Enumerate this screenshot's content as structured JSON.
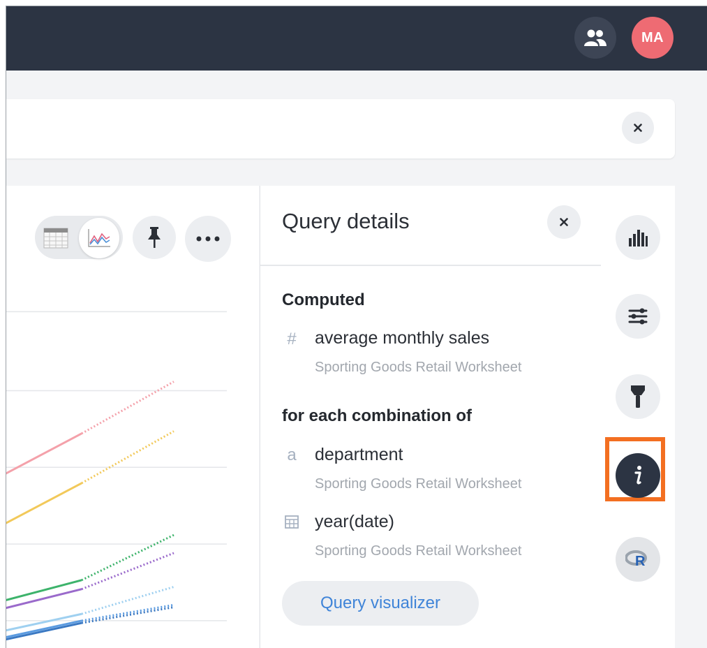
{
  "header": {
    "avatar_initials": "MA"
  },
  "query_details": {
    "title": "Query details",
    "computed_label": "Computed",
    "computed_columns": [
      {
        "type_icon": "#",
        "name": "average monthly sales",
        "source": "Sporting Goods Retail Worksheet"
      }
    ],
    "group_label": "for each combination of",
    "group_columns": [
      {
        "type_icon": "a",
        "name": "department",
        "source": "Sporting Goods Retail Worksheet"
      },
      {
        "type_icon": "calendar-icon",
        "name": "year(date)",
        "source": "Sporting Goods Retail Worksheet"
      }
    ],
    "visualizer_button": "Query visualizer"
  },
  "right_rail": {
    "items": [
      "bar-chart-icon",
      "sliders-icon",
      "paintbrush-icon",
      "info-icon",
      "r-analysis-icon"
    ],
    "active": "info-icon",
    "highlight_color": "#f36f21"
  },
  "colors": {
    "topbar": "#2c3443",
    "avatar": "#ee6b73",
    "accent_link": "#3f84d8"
  },
  "chart_data": {
    "type": "line",
    "series": [
      {
        "color": "#f4a1aa",
        "values": [
          0.58,
          0.92,
          1.15
        ]
      },
      {
        "color": "#f2c95a",
        "values": [
          0.36,
          0.7,
          0.93
        ]
      },
      {
        "color": "#3db36b",
        "values": [
          0.1,
          0.27,
          0.47
        ]
      },
      {
        "color": "#9a6acb",
        "values": [
          0.07,
          0.23,
          0.39
        ]
      },
      {
        "color": "#9fd0f0",
        "values": [
          -0.02,
          0.12,
          0.24
        ]
      },
      {
        "color": "#5b9be0",
        "values": [
          -0.05,
          0.09,
          0.16
        ]
      },
      {
        "color": "#3a78c2",
        "values": [
          -0.06,
          0.08,
          0.15
        ]
      }
    ],
    "solid_until_index": 1,
    "grid": true
  }
}
